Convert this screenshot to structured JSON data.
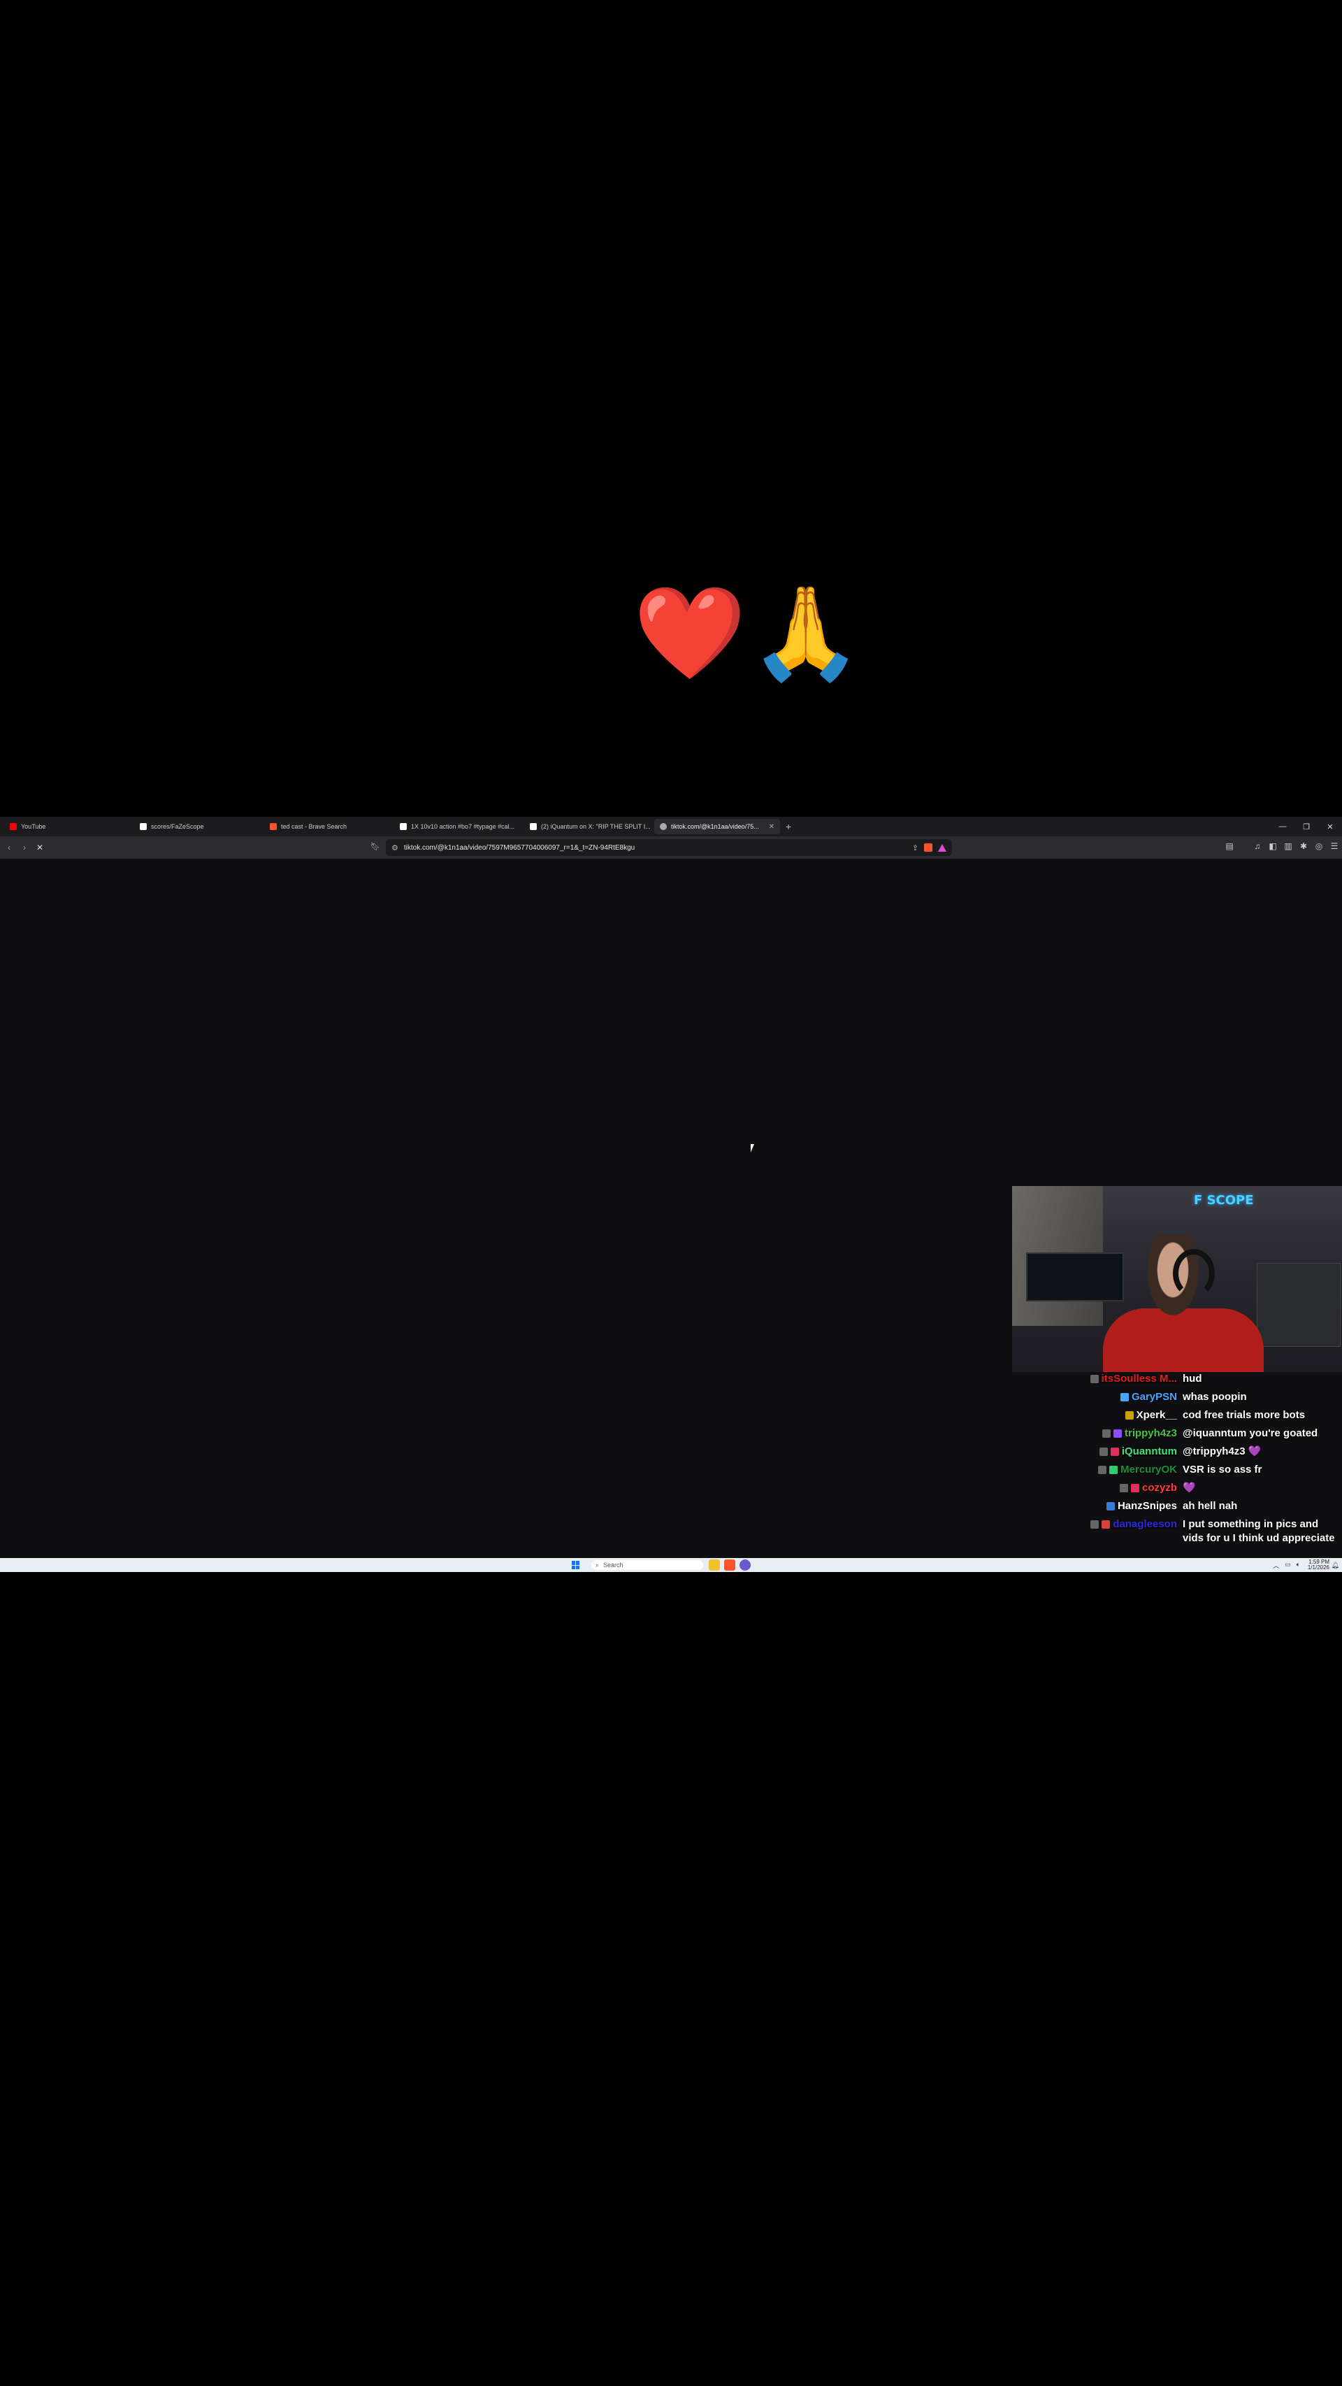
{
  "top_emojis": [
    "😂",
    "❤️",
    "🙏"
  ],
  "browser": {
    "tabs": [
      {
        "label": "YouTube",
        "favicon_color": "#ff0000",
        "active": false
      },
      {
        "label": "scores/FaZeScope",
        "favicon_color": "#ffffff",
        "active": false
      },
      {
        "label": "ted cast - Brave Search",
        "favicon_color": "#fb542b",
        "active": false
      },
      {
        "label": "1X 10v10 action #bo7 #typage #cal...",
        "favicon_color": "#ffffff",
        "active": false
      },
      {
        "label": "(2) iQuantum on X: \"RIP THE SPLIT I...",
        "favicon_color": "#ffffff",
        "active": false
      },
      {
        "label": "tiktok.com/@k1n1aa/video/75...",
        "favicon_color": "#aaaaaa",
        "active": true
      }
    ],
    "new_tab_glyph": "+",
    "url": "tiktok.com/@k1n1aa/video/7597M9657704006097_r=1&_t=ZN-94RtE8kgu",
    "window_controls": {
      "minimize": "—",
      "restore": "❐",
      "close": "✕"
    }
  },
  "stream_chat": [
    {
      "user": "itsSoulless M...",
      "color": "#e11d1d",
      "badges": [
        "#666"
      ],
      "message": "hud"
    },
    {
      "user": "GaryPSN",
      "color": "#4aa3ff",
      "badges": [
        "#4aa3ff"
      ],
      "message": "whas poopin"
    },
    {
      "user": "Xperk__",
      "color": "#ffffff",
      "badges": [
        "#c8a000"
      ],
      "message": "cod free trials more bots"
    },
    {
      "user": "trippyh4z3",
      "color": "#46c43f",
      "badges": [
        "#666",
        "#8e4cff"
      ],
      "message": "@iquanntum you're goated"
    },
    {
      "user": "iQuanntum",
      "color": "#46e07a",
      "badges": [
        "#666",
        "#e0305a"
      ],
      "message": "@trippyh4z3 💜"
    },
    {
      "user": "MercuryOK",
      "color": "#1b8f3a",
      "badges": [
        "#666",
        "#2ecc71"
      ],
      "message": "VSR is so ass fr"
    },
    {
      "user": "cozyzb",
      "color": "#ff3a3a",
      "badges": [
        "#666",
        "#e0305a"
      ],
      "message": "💜"
    },
    {
      "user": "HanzSnipes",
      "color": "#ffffff",
      "badges": [
        "#3a7bd5"
      ],
      "message": "ah hell nah"
    },
    {
      "user": "danagleeson",
      "color": "#2b2bd9",
      "badges": [
        "#666",
        "#d9423b"
      ],
      "message": "I put something in pics and vids for u I think ud appreciate"
    }
  ],
  "taskbar": {
    "search_placeholder": "Search",
    "clock_time": "1:59 PM",
    "clock_date": "1/1/2026"
  }
}
